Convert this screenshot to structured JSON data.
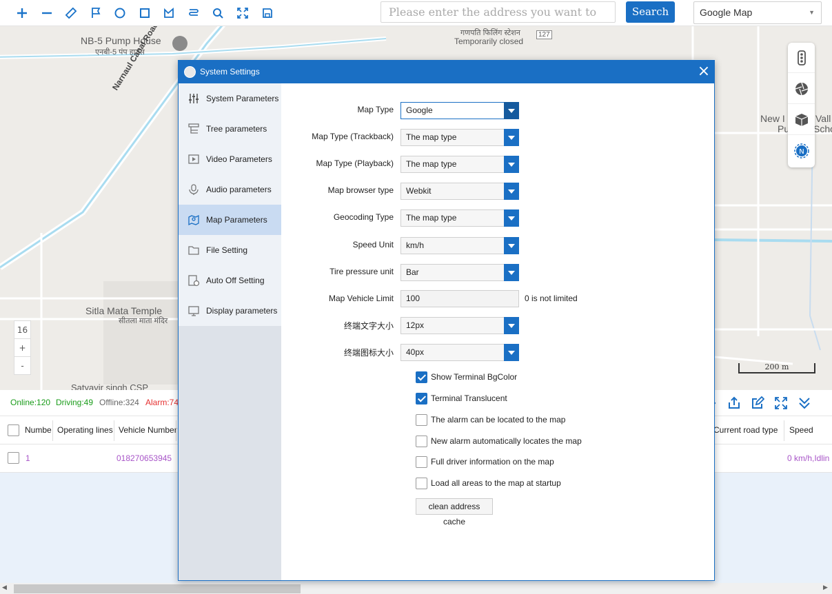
{
  "toolbar": {
    "icons": [
      "zoom-in-icon",
      "zoom-out-icon",
      "ruler-icon",
      "flag-icon",
      "circle-icon",
      "rectangle-icon",
      "polygon-icon",
      "route-icon",
      "search-icon",
      "fullscreen-icon",
      "save-icon"
    ],
    "search_placeholder": "Please enter the address you want to search",
    "search_button": "Search",
    "map_provider": "Google Map"
  },
  "map": {
    "labels": {
      "pump_house": "NB-5 Pump House",
      "pump_house_hindi": "एनबी-5 पंप हाउस",
      "canal_road": "Narnaul Canal Road",
      "filling_station_hindi": "गणपति फिलिंग स्टेशन",
      "temp_closed": "Temporarily closed",
      "route_127": "127",
      "temple": "Sitla Mata Temple",
      "temple_hindi": "सीतला माता मंदिर",
      "new_label": "New I",
      "val_label": "Vall",
      "pu_label": "Pu",
      "scho_label": "Scho",
      "partial_bottom": "Satyavir singh CSP"
    },
    "zoom_level": "16",
    "zoom_in": "+",
    "zoom_out": "-",
    "scale": "200 m",
    "right_tools": [
      "traffic-light-icon",
      "aperture-icon",
      "cube-icon",
      "compass-icon"
    ]
  },
  "status": {
    "online": "Online:120",
    "driving": "Driving:49",
    "offline": "Offline:324",
    "alarm": "Alarm:74",
    "colors": {
      "online": "#1a9c1a",
      "driving": "#1a9c1a",
      "offline": "#666666",
      "alarm": "#e53030"
    },
    "tool_icons": [
      "export-icon",
      "edit-icon",
      "expand-icon",
      "collapse-down-icon"
    ]
  },
  "grid": {
    "columns": [
      "Numbe",
      "Operating lines",
      "Vehicle Number",
      "Current road type",
      "Speed"
    ],
    "row": {
      "number": "1",
      "vehicle": "018270653945",
      "speed": "0 km/h,Idlin"
    }
  },
  "dialog": {
    "title": "System Settings",
    "close": "×",
    "sidebar": [
      {
        "label": "System Parameters",
        "icon": "sliders-icon"
      },
      {
        "label": "Tree parameters",
        "icon": "tree-icon"
      },
      {
        "label": "Video Parameters",
        "icon": "video-icon"
      },
      {
        "label": "Audio parameters",
        "icon": "microphone-icon"
      },
      {
        "label": "Map Parameters",
        "icon": "map-pin-icon"
      },
      {
        "label": "File Setting",
        "icon": "folder-icon"
      },
      {
        "label": "Auto Off Setting",
        "icon": "auto-off-icon"
      },
      {
        "label": "Display parameters",
        "icon": "display-icon"
      }
    ],
    "active_item": "Map Parameters",
    "fields": [
      {
        "label": "Map Type",
        "value": "Google"
      },
      {
        "label": "Map Type (Trackback)",
        "value": "The map type"
      },
      {
        "label": "Map Type (Playback)",
        "value": "The map type"
      },
      {
        "label": "Map browser type",
        "value": "Webkit"
      },
      {
        "label": "Geocoding Type",
        "value": "The map type"
      },
      {
        "label": "Speed Unit",
        "value": "km/h"
      },
      {
        "label": "Tire pressure unit",
        "value": "Bar"
      },
      {
        "label": "Map Vehicle Limit",
        "value": "100",
        "hint": "0 is not limited"
      },
      {
        "label": "终端文字大小",
        "value": "12px"
      },
      {
        "label": "终端图标大小",
        "value": "40px"
      }
    ],
    "checkboxes": [
      {
        "label": "Show Terminal BgColor",
        "checked": true
      },
      {
        "label": "Terminal Translucent",
        "checked": true
      },
      {
        "label": "The alarm can be located to the map",
        "checked": false
      },
      {
        "label": "New alarm automatically locates the map",
        "checked": false
      },
      {
        "label": "Full driver information on the map",
        "checked": false
      },
      {
        "label": "Load all areas to the map at startup",
        "checked": false
      }
    ],
    "clean_button": "clean address cache",
    "accent": "#1a6fc4"
  }
}
